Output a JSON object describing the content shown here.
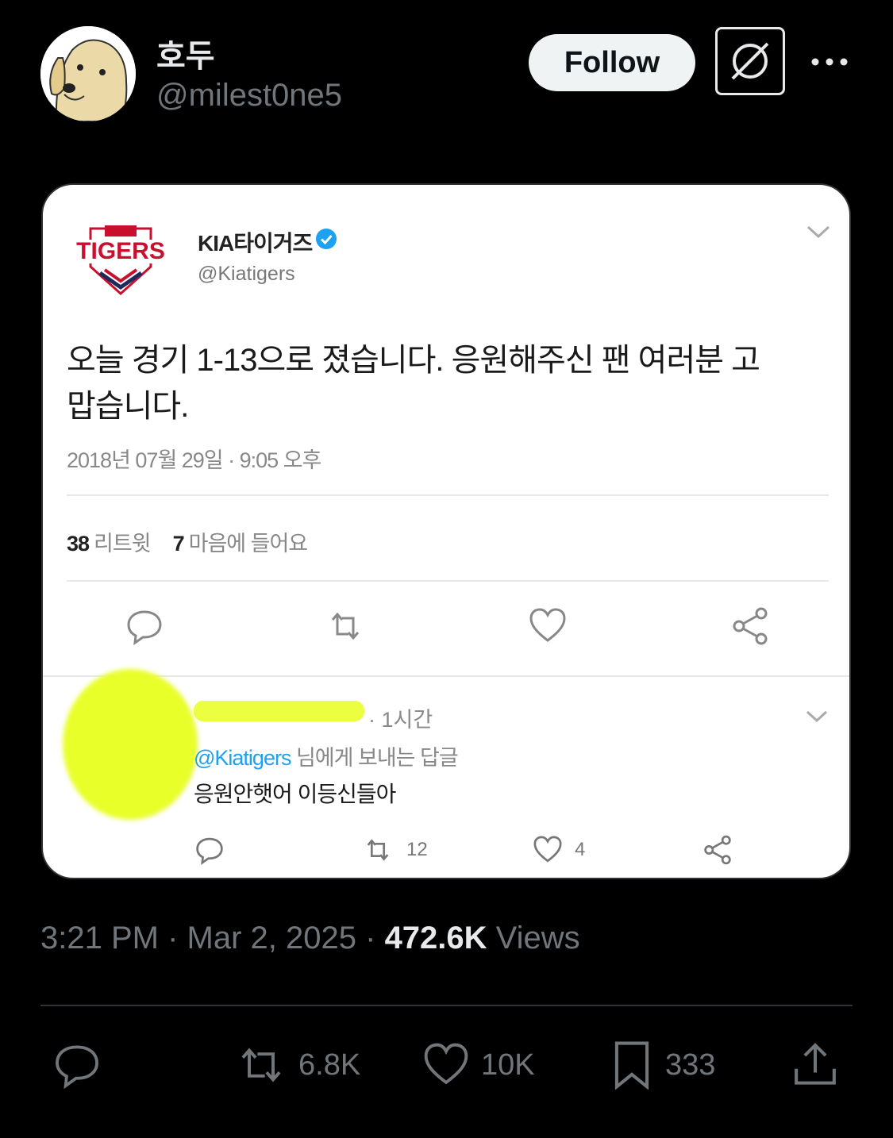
{
  "header": {
    "display_name": "호두",
    "handle": "@milest0ne5",
    "follow_label": "Follow"
  },
  "embedded": {
    "account_name": "KIA타이거즈",
    "account_handle": "@Kiatigers",
    "tweet_text": "오늘 경기 1-13으로 졌습니다. 응원해주신 팬 여러분 고맙습니다.",
    "date": "2018년 07월 29일 · 9:05 오후",
    "retweet_count": "38",
    "retweet_label": "리트윗",
    "like_count": "7",
    "like_label": "마음에 들어요",
    "reply": {
      "time": "· 1시간",
      "reply_to_handle": "@Kiatigers",
      "reply_to_suffix": " 님에게 보내는 답글",
      "text": "응원안햇어 이등신들아",
      "retweets": "12",
      "likes": "4"
    }
  },
  "footer": {
    "time": "3:21 PM",
    "date": "Mar 2, 2025",
    "views_count": "472.6K",
    "views_label": "Views",
    "reposts": "6.8K",
    "likes": "10K",
    "bookmarks": "333"
  }
}
